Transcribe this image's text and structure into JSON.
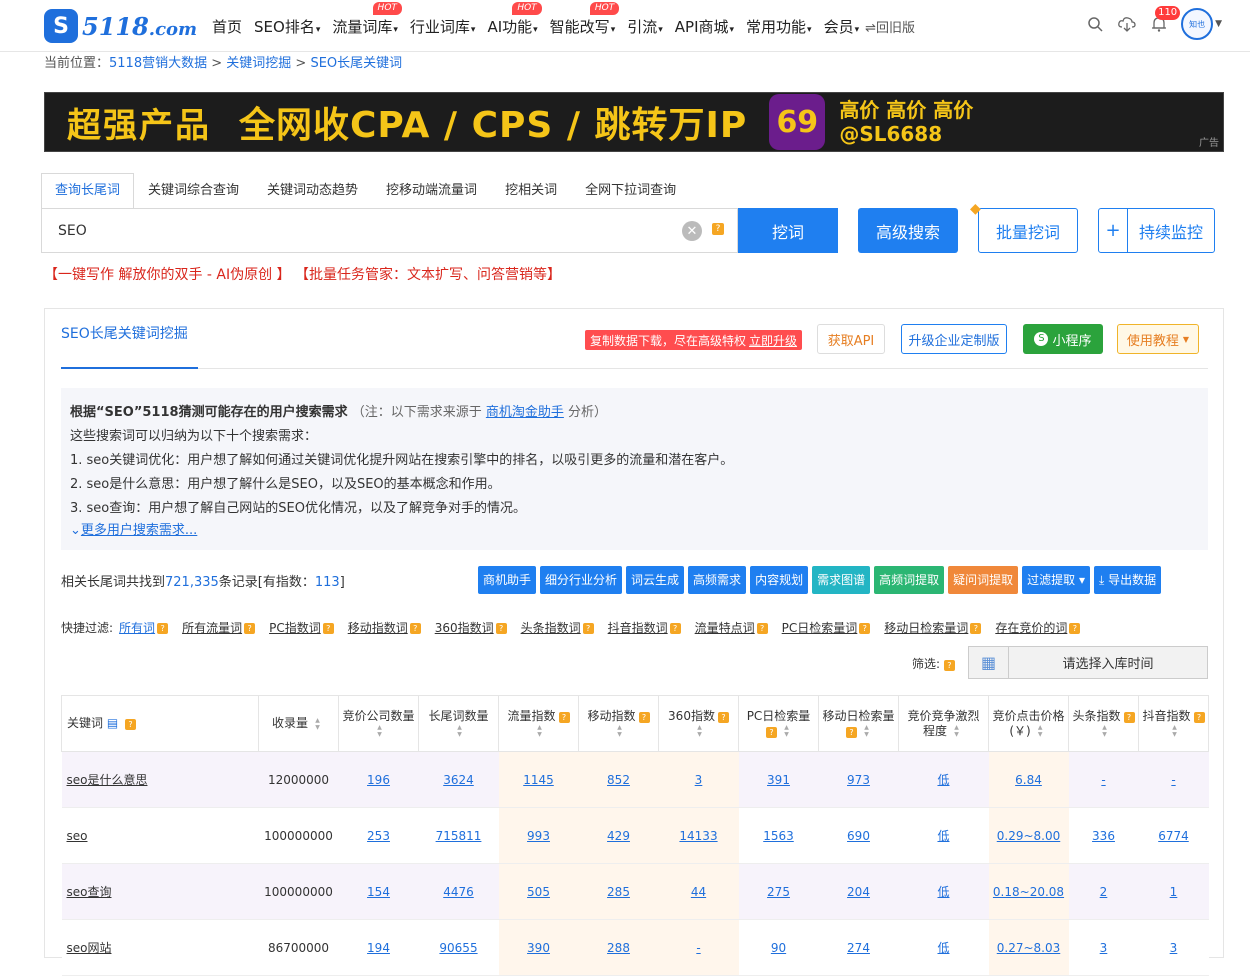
{
  "header": {
    "logo_text": "5118",
    "logo_domain": ".com",
    "nav": [
      {
        "label": "首页",
        "caret": false,
        "hot": false
      },
      {
        "label": "SEO排名",
        "caret": true,
        "hot": false
      },
      {
        "label": "流量词库",
        "caret": true,
        "hot": true
      },
      {
        "label": "行业词库",
        "caret": true,
        "hot": false
      },
      {
        "label": "AI功能",
        "caret": true,
        "hot": true
      },
      {
        "label": "智能改写",
        "caret": true,
        "hot": true
      },
      {
        "label": "引流",
        "caret": true,
        "hot": false
      },
      {
        "label": "API商城",
        "caret": true,
        "hot": false
      },
      {
        "label": "常用功能",
        "caret": true,
        "hot": false
      },
      {
        "label": "会员",
        "caret": true,
        "hot": false
      }
    ],
    "hot_label": "HOT",
    "old_version": "⇌回旧版",
    "notification_count": "110",
    "avatar_text": "知也"
  },
  "breadcrumb": {
    "prefix": "当前位置：",
    "items": [
      "5118营销大数据",
      "关键词挖掘",
      "SEO长尾关键词"
    ],
    "sep": " > "
  },
  "banner": {
    "text1": "超强产品",
    "text2": "全网收CPA / CPS / 跳转万IP",
    "logo": "69",
    "right_top": "高价 高价 高价",
    "right_bottom": "@SL6688",
    "ad_label": "广告"
  },
  "search": {
    "tabs": [
      "查询长尾词",
      "关键词综合查询",
      "关键词动态趋势",
      "挖移动端流量词",
      "挖相关词",
      "全网下拉词查询"
    ],
    "value": "SEO",
    "dig_button": "挖词",
    "advanced_button": "高级搜索",
    "batch_button": "批量挖词",
    "plus_button": "+",
    "monitor_button": "持续监控"
  },
  "promo": {
    "part1": "【一键写作 解放你的双手 - AI伪原创 】",
    "part2": "【批量任务管家：文本扩写、问答营销等】"
  },
  "panel": {
    "title": "SEO长尾关键词挖掘",
    "copy_notice": "复制数据下载，尽在高级特权",
    "upgrade_link": "立即升级",
    "api_button": "获取API",
    "enterprise_button": "升级企业定制版",
    "mini_button": "小程序",
    "guide_button": "使用教程",
    "needs": {
      "heading": "根据“SEO”5118猜测可能存在的用户搜索需求",
      "note_prefix": "（注：以下需求来源于",
      "note_link": "商机淘金助手",
      "note_suffix": "分析）",
      "intro": "这些搜索词可以归纳为以下十个搜索需求：",
      "items": [
        "1. seo关键词优化：用户想了解如何通过关键词优化提升网站在搜索引擎中的排名，以吸引更多的流量和潜在客户。",
        "2. seo是什么意思：用户想了解什么是SEO，以及SEO的基本概念和作用。",
        "3. seo查询：用户想了解自己网站的SEO优化情况，以及了解竞争对手的情况。"
      ],
      "more": "更多用户搜索需求..."
    },
    "summary_prefix": "相关长尾词共找到",
    "summary_count": "721,335",
    "summary_mid": "条记录[有指数：",
    "summary_index": "113",
    "summary_suffix": "]",
    "tools": [
      {
        "label": "商机助手",
        "color": "#1f7ff0"
      },
      {
        "label": "细分行业分析",
        "color": "#1f7ff0"
      },
      {
        "label": "词云生成",
        "color": "#1f7ff0"
      },
      {
        "label": "高频需求",
        "color": "#1f7ff0"
      },
      {
        "label": "内容规划",
        "color": "#1f7ff0"
      },
      {
        "label": "需求图谱",
        "color": "#23b5c4"
      },
      {
        "label": "高频词提取",
        "color": "#2bb673"
      },
      {
        "label": "疑问词提取",
        "color": "#f0883a"
      },
      {
        "label": "过滤提取 ▾",
        "color": "#1f7ff0"
      },
      {
        "label": "⤓ 导出数据",
        "color": "#1f7ff0"
      }
    ],
    "quick_filter_label": "快捷过滤:",
    "quick_filters": [
      "所有词",
      "所有流量词",
      "PC指数词",
      "移动指数词",
      "360指数词",
      "头条指数词",
      "抖音指数词",
      "流量特点词",
      "PC日检索量词",
      "移动日检索量词",
      "存在竞价的词"
    ],
    "filter_label": "筛选:",
    "date_button": "请选择入库时间",
    "columns": [
      "关键词",
      "收录量",
      "竞价公司数量",
      "长尾词数量",
      "流量指数",
      "移动指数",
      "360指数",
      "PC日检索量",
      "移动日检索量",
      "竞价竞争激烈程度",
      "竞价点击价格(￥)",
      "头条指数",
      "抖音指数"
    ],
    "rows": [
      {
        "keyword": "seo是什么意思",
        "index_count": "12000000",
        "bid_companies": "196",
        "longtail": "3624",
        "traffic": "1145",
        "mobile": "852",
        "i360": "3",
        "pc_daily": "391",
        "mobile_daily": "973",
        "competition": "低",
        "cpc": "6.84",
        "toutiao": "-",
        "douyin": "-"
      },
      {
        "keyword": "seo",
        "index_count": "100000000",
        "bid_companies": "253",
        "longtail": "715811",
        "traffic": "993",
        "mobile": "429",
        "i360": "14133",
        "pc_daily": "1563",
        "mobile_daily": "690",
        "competition": "低",
        "cpc": "0.29~8.00",
        "toutiao": "336",
        "douyin": "6774"
      },
      {
        "keyword": "seo查询",
        "index_count": "100000000",
        "bid_companies": "154",
        "longtail": "4476",
        "traffic": "505",
        "mobile": "285",
        "i360": "44",
        "pc_daily": "275",
        "mobile_daily": "204",
        "competition": "低",
        "cpc": "0.18~20.08",
        "toutiao": "2",
        "douyin": "1"
      },
      {
        "keyword": "seo网站",
        "index_count": "86700000",
        "bid_companies": "194",
        "longtail": "90655",
        "traffic": "390",
        "mobile": "288",
        "i360": "-",
        "pc_daily": "90",
        "mobile_daily": "274",
        "competition": "低",
        "cpc": "0.27~8.03",
        "toutiao": "3",
        "douyin": "3"
      }
    ]
  }
}
